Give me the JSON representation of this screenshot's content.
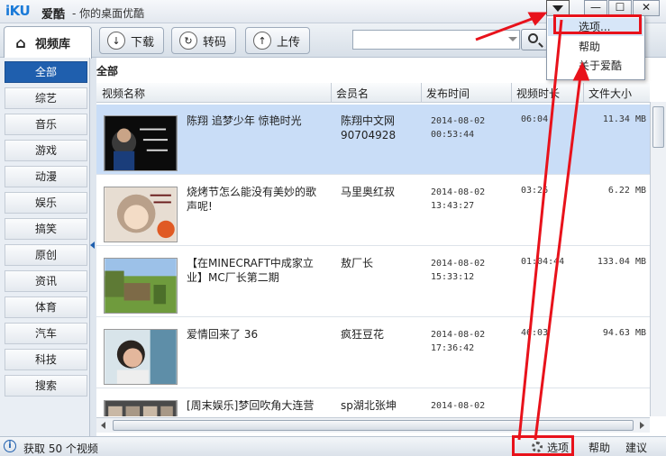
{
  "titlebar": {
    "logo": "iKU",
    "app_name": "爱酷",
    "slogan": "- 你的桌面优酷",
    "min": "—",
    "max": "☐",
    "close": "✕"
  },
  "toolbar": {
    "tabs": [
      {
        "label": "视频库",
        "icon": "home-icon"
      },
      {
        "label": "下载",
        "icon": "download-icon"
      },
      {
        "label": "转码",
        "icon": "transcode-icon"
      },
      {
        "label": "上传",
        "icon": "upload-icon"
      }
    ],
    "search_value": ""
  },
  "sidebar": {
    "items": [
      "全部",
      "综艺",
      "音乐",
      "游戏",
      "动漫",
      "娱乐",
      "搞笑",
      "原创",
      "资讯",
      "体育",
      "汽车",
      "科技",
      "搜索"
    ]
  },
  "main": {
    "title": "全部",
    "columns": [
      "视频名称",
      "会员名",
      "发布时间",
      "视频时长",
      "文件大小"
    ],
    "rows": [
      {
        "title": "陈翔 追梦少年 惊艳时光",
        "user": "陈翔中文网\n90704928",
        "date": "2014-08-02",
        "time": "00:53:44",
        "duration": "06:04",
        "size": "11.34 MB"
      },
      {
        "title": "烧烤节怎么能没有美妙的歌声呢!",
        "user": "马里奥红叔",
        "date": "2014-08-02",
        "time": "13:43:27",
        "duration": "03:26",
        "size": "6.22 MB"
      },
      {
        "title": "【在MINECRAFT中成家立业】MC厂长第二期",
        "user": "敖厂长",
        "date": "2014-08-02",
        "time": "15:33:12",
        "duration": "01:04:44",
        "size": "133.04 MB"
      },
      {
        "title": "爱情回来了 36",
        "user": "疯狂豆花",
        "date": "2014-08-02",
        "time": "17:36:42",
        "duration": "46:03",
        "size": "94.63 MB"
      },
      {
        "title": "[周末娱乐]梦回吹角大连营",
        "user": "sp湖北张坤",
        "date": "2014-08-02",
        "time": "",
        "duration": "",
        "size": ""
      }
    ]
  },
  "statusbar": {
    "text": "获取 50 个视频",
    "options": "选项",
    "help": "帮助",
    "suggest": "建议"
  },
  "menu": {
    "items": [
      "选项...",
      "帮助",
      "关于爱酷"
    ]
  },
  "colors": {
    "accent": "#1f5fae",
    "selected_row": "#c9ddf7",
    "annotation_red": "#e8121b"
  }
}
